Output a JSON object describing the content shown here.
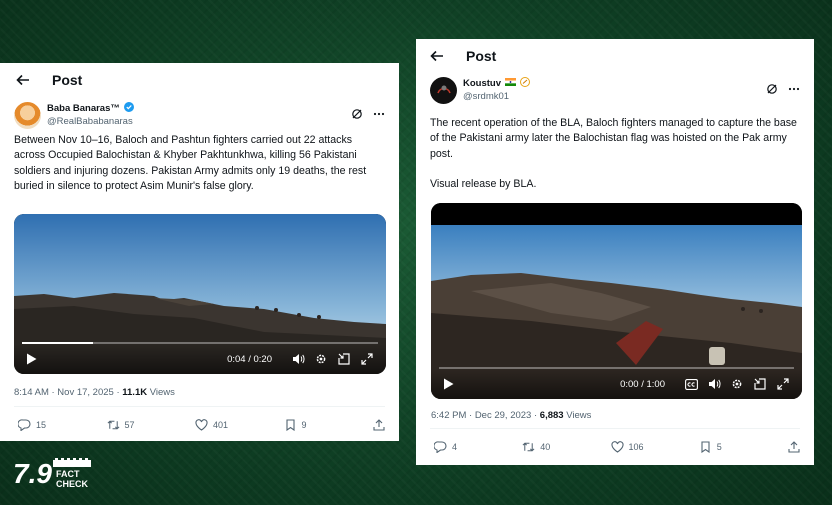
{
  "post1": {
    "header_title": "Post",
    "author_name": "Baba Banaras™",
    "author_handle": "@RealBababanaras",
    "text": "Between Nov 10–16, Baloch and Pashtun fighters carried out 22 attacks across Occupied Balochistan & Khyber Pakhtunkhwa, killing 56 Pakistani soldiers and injuring dozens. Pakistan Army admits only 19 deaths, the rest buried in silence to protect Asim Munir's false glory.",
    "video_time": "0:04 / 0:20",
    "video_progress": 0.2,
    "timestamp": "8:14 AM · Nov 17, 2025 · ",
    "views_count": "11.1K",
    "views_label": " Views",
    "replies": "15",
    "reposts": "57",
    "likes": "401",
    "bookmarks": "9"
  },
  "post2": {
    "header_title": "Post",
    "author_name": "Koustuv",
    "author_handle": "@srdmk01",
    "text": "The recent operation of the BLA, Baloch fighters managed to capture the base of the Pakistani army later the Balochistan flag was hoisted on the Pak army post.",
    "text2": "Visual release by BLA.",
    "video_time": "0:00 / 1:00",
    "video_progress": 0.0,
    "timestamp": "6:42 PM · Dec 29, 2023 · ",
    "views_count": "6,883",
    "views_label": " Views",
    "replies": "4",
    "reposts": "40",
    "likes": "106",
    "bookmarks": "5"
  },
  "logo": {
    "mark": "7.9",
    "line1": "FACT",
    "line2": "CHECK"
  },
  "colors": {
    "background": "#0f3d23",
    "verified": "#1d9bf0",
    "muted_text": "#536471"
  }
}
